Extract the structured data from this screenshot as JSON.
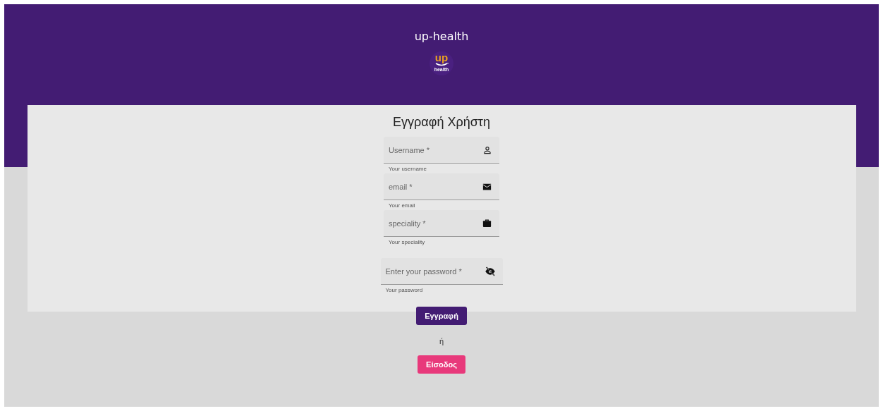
{
  "header": {
    "title": "up-health",
    "logo": {
      "mark": "up",
      "caption": "health"
    }
  },
  "form": {
    "title": "Εγγραφή Χρήστη",
    "fields": [
      {
        "kind": "username",
        "placeholder": "Username *",
        "hint": "Your username"
      },
      {
        "kind": "email",
        "placeholder": "email *",
        "hint": "Your email"
      },
      {
        "kind": "speciality",
        "placeholder": "speciality *",
        "hint": "Your speciality"
      },
      {
        "kind": "password",
        "placeholder": "Enter your password *",
        "hint": "Your password"
      }
    ]
  },
  "register_button": "Εγγραφή",
  "separator": "ή",
  "login_button": "Είσοδος"
}
